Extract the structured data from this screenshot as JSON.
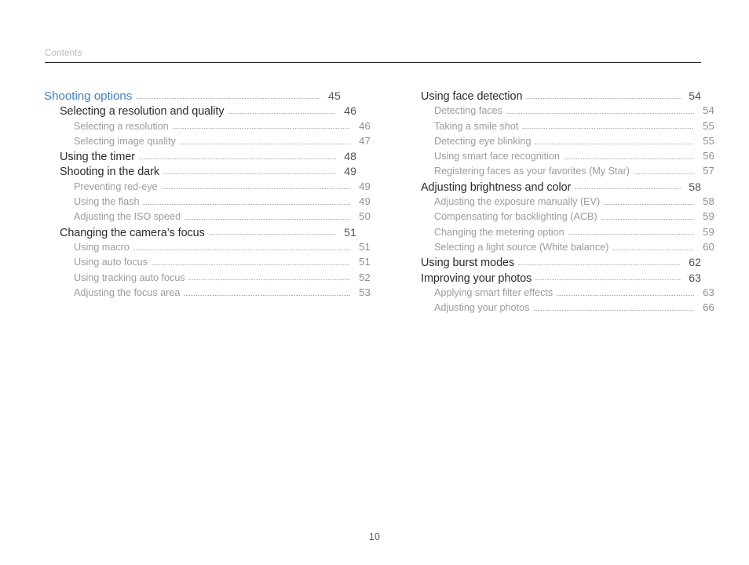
{
  "header": {
    "title": "Contents"
  },
  "footer": {
    "page_number": "10"
  },
  "colors": {
    "section_blue": "#3e80c6",
    "heading_dark": "#2b2b2b",
    "subitem_gray": "#9c9c9c",
    "header_gray": "#b8b8b8",
    "rule_black": "#1a1a1a",
    "background": "#ffffff"
  },
  "columns": {
    "left": {
      "entries": [
        {
          "level": 1,
          "label": "Shooting options",
          "page": "45"
        },
        {
          "level": 2,
          "label": "Selecting a resolution and quality",
          "page": "46"
        },
        {
          "level": 3,
          "label": "Selecting a resolution",
          "page": "46"
        },
        {
          "level": 3,
          "label": "Selecting image quality",
          "page": "47"
        },
        {
          "level": 2,
          "label": "Using the timer",
          "page": "48"
        },
        {
          "level": 2,
          "label": "Shooting in the dark",
          "page": "49"
        },
        {
          "level": 3,
          "label": "Preventing red-eye",
          "page": "49"
        },
        {
          "level": 3,
          "label": "Using the flash",
          "page": "49"
        },
        {
          "level": 3,
          "label": "Adjusting the ISO speed",
          "page": "50"
        },
        {
          "level": 2,
          "label": "Changing the camera’s focus",
          "page": "51"
        },
        {
          "level": 3,
          "label": "Using macro",
          "page": "51"
        },
        {
          "level": 3,
          "label": "Using auto focus",
          "page": "51"
        },
        {
          "level": 3,
          "label": "Using tracking auto focus",
          "page": "52"
        },
        {
          "level": 3,
          "label": "Adjusting the focus area",
          "page": "53"
        }
      ]
    },
    "right": {
      "entries": [
        {
          "level": 2,
          "label": "Using face detection",
          "page": "54"
        },
        {
          "level": 3,
          "label": "Detecting faces",
          "page": "54"
        },
        {
          "level": 3,
          "label": "Taking a smile shot",
          "page": "55"
        },
        {
          "level": 3,
          "label": "Detecting eye blinking",
          "page": "55"
        },
        {
          "level": 3,
          "label": "Using smart face recognition",
          "page": "56"
        },
        {
          "level": 3,
          "label": "Registering faces as your favorites (My Star)",
          "page": "57"
        },
        {
          "level": 2,
          "label": "Adjusting brightness and color",
          "page": "58"
        },
        {
          "level": 3,
          "label": "Adjusting the exposure manually (EV)",
          "page": "58"
        },
        {
          "level": 3,
          "label": "Compensating for backlighting (ACB)",
          "page": "59"
        },
        {
          "level": 3,
          "label": "Changing the metering option",
          "page": "59"
        },
        {
          "level": 3,
          "label": "Selecting a light source (White balance)",
          "page": "60"
        },
        {
          "level": 2,
          "label": "Using burst modes",
          "page": "62"
        },
        {
          "level": 2,
          "label": "Improving your photos",
          "page": "63"
        },
        {
          "level": 3,
          "label": "Applying smart filter effects",
          "page": "63"
        },
        {
          "level": 3,
          "label": "Adjusting your photos",
          "page": "66"
        }
      ]
    }
  }
}
